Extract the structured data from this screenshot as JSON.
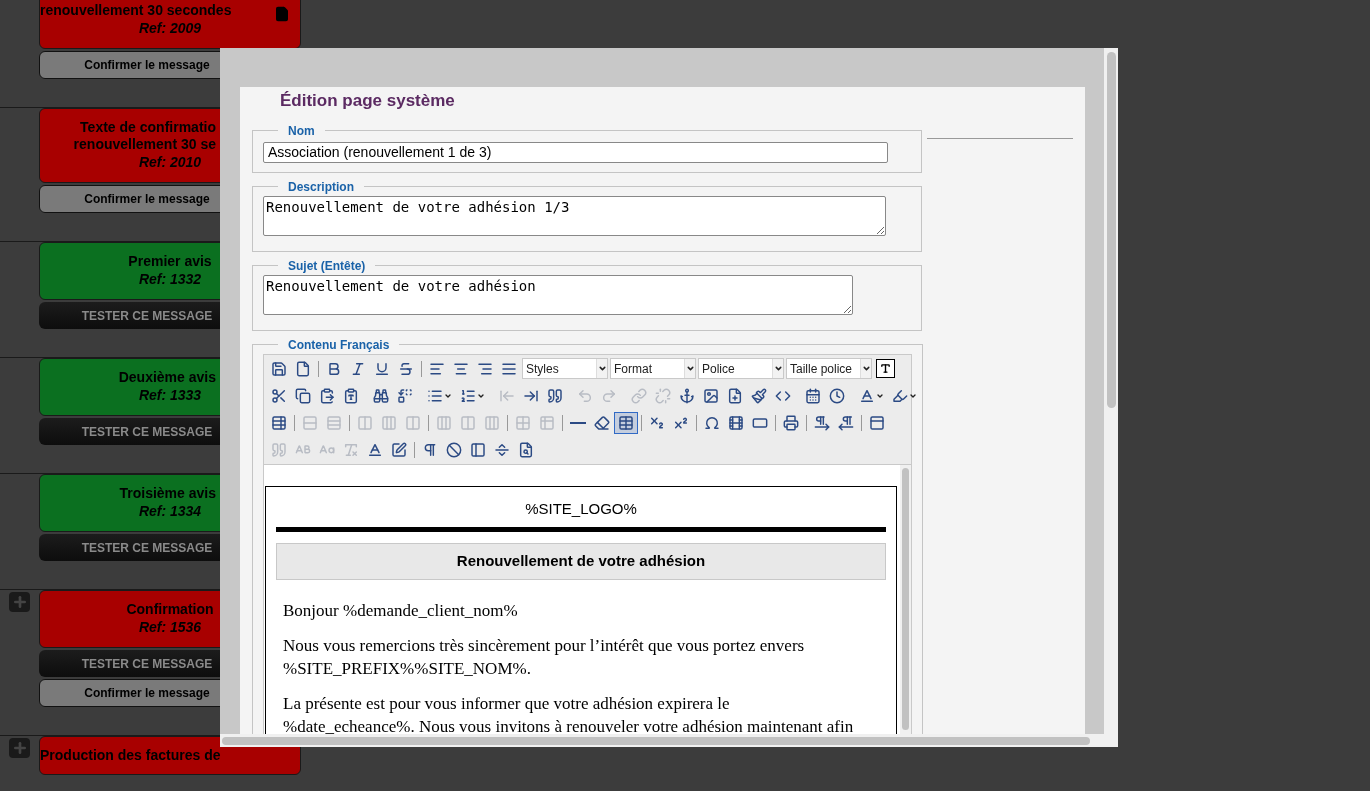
{
  "background_cards": [
    {
      "title_lines": [
        "renouvellement 30 secondes"
      ],
      "ref": "Ref: 2009",
      "color": "#a80000",
      "doc_icon": true,
      "plus": false,
      "buttons": [
        {
          "kind": "confirm",
          "label": "Confirmer le message"
        }
      ]
    },
    {
      "title_lines": [
        "Texte de confirmatio",
        "renouvellement 30 se"
      ],
      "ref": "Ref: 2010",
      "color": "#a80000",
      "plus": false,
      "buttons": [
        {
          "kind": "confirm",
          "label": "Confirmer le message"
        }
      ]
    },
    {
      "title_lines": [
        "Premier avis"
      ],
      "ref": "Ref: 1332",
      "color": "#0b7020",
      "plus": false,
      "buttons": [
        {
          "kind": "test",
          "label": "TESTER CE MESSAGE"
        }
      ]
    },
    {
      "title_lines": [
        "Deuxième avis"
      ],
      "ref": "Ref: 1333",
      "color": "#0b7020",
      "plus": false,
      "buttons": [
        {
          "kind": "test",
          "label": "TESTER CE MESSAGE"
        }
      ]
    },
    {
      "title_lines": [
        "Troisième avis"
      ],
      "ref": "Ref: 1334",
      "color": "#0b7020",
      "plus": false,
      "buttons": [
        {
          "kind": "test",
          "label": "TESTER CE MESSAGE"
        }
      ]
    },
    {
      "title_lines": [
        "Confirmation"
      ],
      "ref": "Ref: 1536",
      "color": "#a80000",
      "plus": true,
      "buttons": [
        {
          "kind": "test",
          "label": "TESTER CE MESSAGE"
        },
        {
          "kind": "confirm",
          "label": "Confirmer le message"
        }
      ]
    },
    {
      "title_lines": [
        "Production des factures de"
      ],
      "color": "#a80000",
      "plus": true
    }
  ],
  "dialog": {
    "title": "Édition page système",
    "fields": [
      {
        "kind": "input",
        "legend": "Nom",
        "value": "Association (renouvellement 1 de 3)"
      },
      {
        "kind": "textarea",
        "legend": "Description",
        "value": "Renouvellement de votre adhésion 1/3"
      },
      {
        "kind": "textarea",
        "legend": "Sujet (Entête)",
        "value": "Renouvellement de votre adhésion"
      }
    ],
    "editor": {
      "legend": "Contenu Français",
      "toolbar": [
        [
          {
            "kind": "button",
            "disabled": false,
            "selected": false
          },
          {
            "kind": "button",
            "disabled": false,
            "selected": false
          },
          {
            "kind": "separator"
          },
          {
            "kind": "button",
            "disabled": false,
            "selected": false
          },
          {
            "kind": "button",
            "disabled": false,
            "selected": false
          },
          {
            "kind": "button",
            "disabled": false,
            "selected": false
          },
          {
            "kind": "button",
            "disabled": false,
            "selected": false
          },
          {
            "kind": "separator"
          },
          {
            "kind": "button",
            "disabled": false,
            "selected": false
          },
          {
            "kind": "button",
            "disabled": false,
            "selected": false
          },
          {
            "kind": "button",
            "disabled": false,
            "selected": false
          },
          {
            "kind": "button",
            "disabled": false,
            "selected": false
          },
          {
            "kind": "select",
            "value": "Styles"
          },
          {
            "kind": "select",
            "value": "Format"
          },
          {
            "kind": "select",
            "value": "Police"
          },
          {
            "kind": "select",
            "value": "Taille police"
          },
          {
            "kind": "boxed",
            "disabled": false,
            "selected": false
          }
        ],
        [
          {
            "kind": "button",
            "disabled": false,
            "selected": false
          },
          {
            "kind": "button",
            "disabled": false,
            "selected": false
          },
          {
            "kind": "button",
            "disabled": false,
            "selected": false
          },
          {
            "kind": "button",
            "disabled": false,
            "selected": false
          },
          {
            "kind": "separator"
          },
          {
            "kind": "button",
            "disabled": false,
            "selected": false
          },
          {
            "kind": "button",
            "disabled": false,
            "selected": false
          },
          {
            "kind": "separator"
          },
          {
            "kind": "dropdown",
            "disabled": false,
            "selected": false
          },
          {
            "kind": "dropdown",
            "disabled": false,
            "selected": false
          },
          {
            "kind": "separator"
          },
          {
            "kind": "button",
            "disabled": true,
            "selected": false
          },
          {
            "kind": "button",
            "disabled": false,
            "selected": false
          },
          {
            "kind": "button",
            "disabled": false,
            "selected": false
          },
          {
            "kind": "separator"
          },
          {
            "kind": "button",
            "disabled": true,
            "selected": false
          },
          {
            "kind": "button",
            "disabled": true,
            "selected": false
          },
          {
            "kind": "separator"
          },
          {
            "kind": "button",
            "disabled": true,
            "selected": false
          },
          {
            "kind": "button",
            "disabled": true,
            "selected": false
          },
          {
            "kind": "button",
            "disabled": false,
            "selected": false
          },
          {
            "kind": "button",
            "disabled": false,
            "selected": false
          },
          {
            "kind": "button",
            "disabled": false,
            "selected": false
          },
          {
            "kind": "button",
            "disabled": false,
            "selected": false
          },
          {
            "kind": "button",
            "disabled": false,
            "selected": false
          },
          {
            "kind": "separator"
          },
          {
            "kind": "button",
            "disabled": false,
            "selected": false
          },
          {
            "kind": "button",
            "disabled": false,
            "selected": false
          },
          {
            "kind": "separator"
          },
          {
            "kind": "dropdown",
            "disabled": false,
            "selected": false
          },
          {
            "kind": "dropdown",
            "disabled": false,
            "selected": false
          }
        ],
        [
          {
            "kind": "button",
            "disabled": false,
            "selected": false
          },
          {
            "kind": "separator"
          },
          {
            "kind": "button",
            "disabled": true,
            "selected": false
          },
          {
            "kind": "button",
            "disabled": true,
            "selected": false
          },
          {
            "kind": "separator"
          },
          {
            "kind": "button",
            "disabled": true,
            "selected": false
          },
          {
            "kind": "button",
            "disabled": true,
            "selected": false
          },
          {
            "kind": "button",
            "disabled": true,
            "selected": false
          },
          {
            "kind": "separator"
          },
          {
            "kind": "button",
            "disabled": true,
            "selected": false
          },
          {
            "kind": "button",
            "disabled": true,
            "selected": false
          },
          {
            "kind": "button",
            "disabled": true,
            "selected": false
          },
          {
            "kind": "separator"
          },
          {
            "kind": "button",
            "disabled": true,
            "selected": false
          },
          {
            "kind": "button",
            "disabled": true,
            "selected": false
          },
          {
            "kind": "separator"
          },
          {
            "kind": "button",
            "disabled": false,
            "selected": false
          },
          {
            "kind": "button",
            "disabled": false,
            "selected": false
          },
          {
            "kind": "button",
            "disabled": false,
            "selected": true
          },
          {
            "kind": "separator"
          },
          {
            "kind": "button",
            "disabled": false,
            "selected": false
          },
          {
            "kind": "button",
            "disabled": false,
            "selected": false
          },
          {
            "kind": "separator"
          },
          {
            "kind": "button",
            "disabled": false,
            "selected": false
          },
          {
            "kind": "button",
            "disabled": false,
            "selected": false
          },
          {
            "kind": "button",
            "disabled": false,
            "selected": false
          },
          {
            "kind": "separator"
          },
          {
            "kind": "button",
            "disabled": false,
            "selected": false
          },
          {
            "kind": "separator"
          },
          {
            "kind": "button",
            "disabled": false,
            "selected": false
          },
          {
            "kind": "button",
            "disabled": false,
            "selected": false
          },
          {
            "kind": "separator"
          },
          {
            "kind": "button",
            "disabled": false,
            "selected": false
          }
        ],
        [
          {
            "kind": "button",
            "disabled": true,
            "selected": false
          },
          {
            "kind": "button",
            "disabled": true,
            "selected": false
          },
          {
            "kind": "button",
            "disabled": true,
            "selected": false
          },
          {
            "kind": "button",
            "disabled": true,
            "selected": false
          },
          {
            "kind": "button",
            "disabled": false,
            "selected": false
          },
          {
            "kind": "button",
            "disabled": false,
            "selected": false
          },
          {
            "kind": "separator"
          },
          {
            "kind": "button",
            "disabled": false,
            "selected": false
          },
          {
            "kind": "button",
            "disabled": false,
            "selected": false
          },
          {
            "kind": "button",
            "disabled": false,
            "selected": false
          },
          {
            "kind": "button",
            "disabled": false,
            "selected": false
          },
          {
            "kind": "button",
            "disabled": false,
            "selected": false
          }
        ]
      ],
      "content": {
        "logo_placeholder": "%SITE_LOGO%",
        "heading": "Renouvellement de votre adhésion",
        "paragraphs": [
          [
            "Bonjour %demande_client_nom%"
          ],
          [
            "Nous vous remercions très sincèrement pour l’intérêt que vous portez envers",
            "%SITE_PREFIX%%SITE_NOM%."
          ],
          [
            "La présente est pour vous informer que votre adhésion expirera le",
            "%date_echeance%. Nous vous invitons à renouveler votre adhésion maintenant afin"
          ]
        ]
      }
    }
  }
}
